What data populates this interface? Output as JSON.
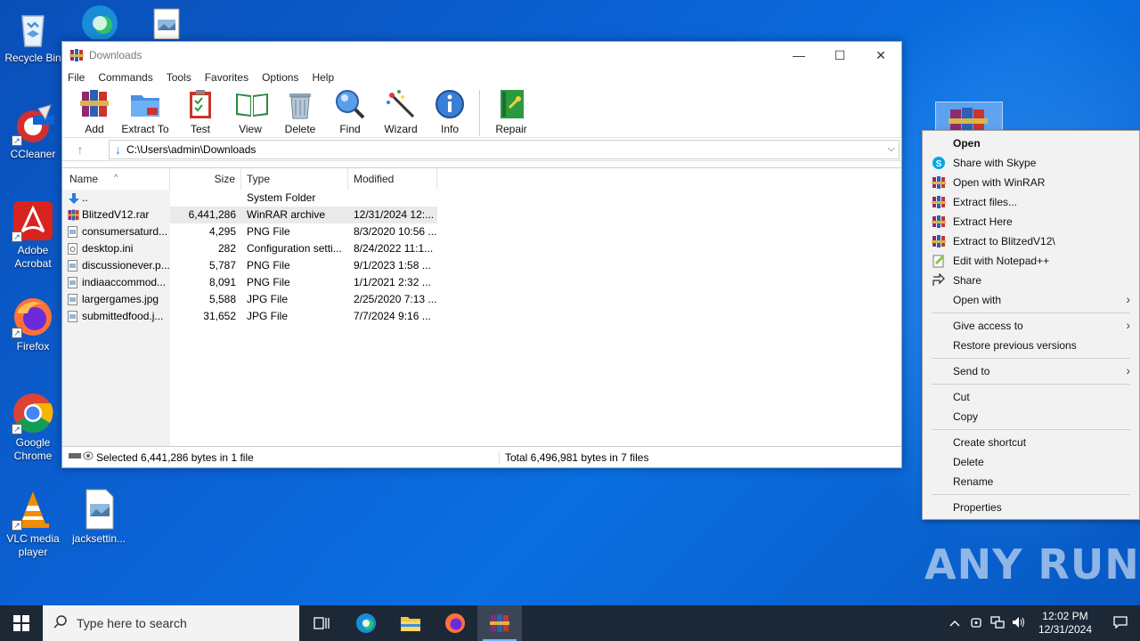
{
  "desktop": {
    "icons": [
      {
        "label": "Recycle Bin"
      },
      {
        "label": "CCleaner"
      },
      {
        "label": "Adobe Acrobat"
      },
      {
        "label": "Firefox"
      },
      {
        "label": "Google Chrome"
      },
      {
        "label": "VLC media player"
      },
      {
        "label": "jacksettin..."
      }
    ],
    "watermark": "ANY RUN"
  },
  "window": {
    "title": "Downloads",
    "controls": {
      "minimize": "—",
      "maximize": "☐",
      "close": "✕"
    },
    "menu": [
      "File",
      "Commands",
      "Tools",
      "Favorites",
      "Options",
      "Help"
    ],
    "toolbar": [
      "Add",
      "Extract To",
      "Test",
      "View",
      "Delete",
      "Find",
      "Wizard",
      "Info",
      "Repair"
    ],
    "path": "C:\\Users\\admin\\Downloads",
    "columns": [
      "Name",
      "Size",
      "Type",
      "Modified"
    ],
    "files": [
      {
        "name": "..",
        "size": "",
        "type": "System Folder",
        "modified": "",
        "icon": "up-folder-icon"
      },
      {
        "name": "BlitzedV12.rar",
        "size": "6,441,286",
        "type": "WinRAR archive",
        "modified": "12/31/2024 12:...",
        "icon": "rar-file-icon",
        "selected": true
      },
      {
        "name": "consumersaturd...",
        "size": "4,295",
        "type": "PNG File",
        "modified": "8/3/2020 10:56 ...",
        "icon": "image-file-icon"
      },
      {
        "name": "desktop.ini",
        "size": "282",
        "type": "Configuration setti...",
        "modified": "8/24/2022 11:1...",
        "icon": "config-file-icon"
      },
      {
        "name": "discussionever.p...",
        "size": "5,787",
        "type": "PNG File",
        "modified": "9/1/2023 1:58 ...",
        "icon": "image-file-icon"
      },
      {
        "name": "indiaaccommod...",
        "size": "8,091",
        "type": "PNG File",
        "modified": "1/1/2021 2:32 ...",
        "icon": "image-file-icon"
      },
      {
        "name": "largergames.jpg",
        "size": "5,588",
        "type": "JPG File",
        "modified": "2/25/2020 7:13 ...",
        "icon": "image-file-icon"
      },
      {
        "name": "submittedfood.j...",
        "size": "31,652",
        "type": "JPG File",
        "modified": "7/7/2024 9:16 ...",
        "icon": "image-file-icon"
      }
    ],
    "status_left": "Selected 6,441,286 bytes in 1 file",
    "status_right": "Total 6,496,981 bytes in 7 files"
  },
  "context_menu": {
    "groups": [
      [
        {
          "label": "Open",
          "bold": true
        },
        {
          "label": "Share with Skype",
          "icon": "skype-icon"
        },
        {
          "label": "Open with WinRAR",
          "icon": "winrar-icon"
        },
        {
          "label": "Extract files...",
          "icon": "winrar-icon"
        },
        {
          "label": "Extract Here",
          "icon": "winrar-icon"
        },
        {
          "label": "Extract to BlitzedV12\\",
          "icon": "winrar-icon"
        },
        {
          "label": "Edit with Notepad++",
          "icon": "notepadpp-icon"
        },
        {
          "label": "Share",
          "icon": "share-icon"
        },
        {
          "label": "Open with",
          "submenu": true
        }
      ],
      [
        {
          "label": "Give access to",
          "submenu": true
        },
        {
          "label": "Restore previous versions"
        }
      ],
      [
        {
          "label": "Send to",
          "submenu": true
        }
      ],
      [
        {
          "label": "Cut"
        },
        {
          "label": "Copy"
        }
      ],
      [
        {
          "label": "Create shortcut"
        },
        {
          "label": "Delete"
        },
        {
          "label": "Rename"
        }
      ],
      [
        {
          "label": "Properties"
        }
      ]
    ]
  },
  "taskbar": {
    "search_placeholder": "Type here to search",
    "time": "12:02 PM",
    "date": "12/31/2024"
  },
  "colors": {
    "desktop_blue": "#0b63d6",
    "taskbar": "#1d2836",
    "context_menu_bg": "#f2f2f2"
  }
}
